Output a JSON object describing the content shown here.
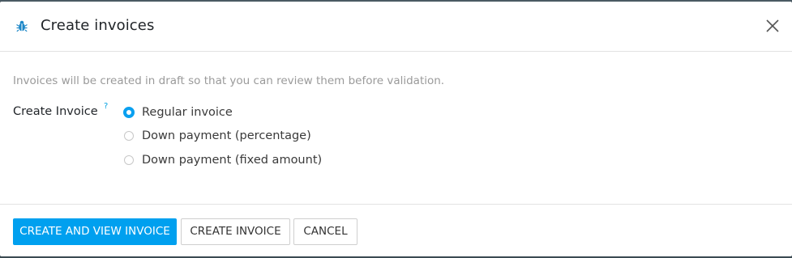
{
  "dialog": {
    "title": "Create invoices",
    "icon": "bug-icon",
    "close_icon": "close-icon"
  },
  "body": {
    "note": "Invoices will be created in draft so that you can review them before validation.",
    "field_label": "Create Invoice",
    "help_marker": "?",
    "options": [
      {
        "label": "Regular invoice",
        "checked": true
      },
      {
        "label": "Down payment (percentage)",
        "checked": false
      },
      {
        "label": "Down payment (fixed amount)",
        "checked": false
      }
    ]
  },
  "footer": {
    "primary_label": "CREATE AND VIEW INVOICE",
    "create_label": "CREATE INVOICE",
    "cancel_label": "CANCEL"
  },
  "colors": {
    "accent": "#00a0ef",
    "help": "#00a0e0"
  }
}
